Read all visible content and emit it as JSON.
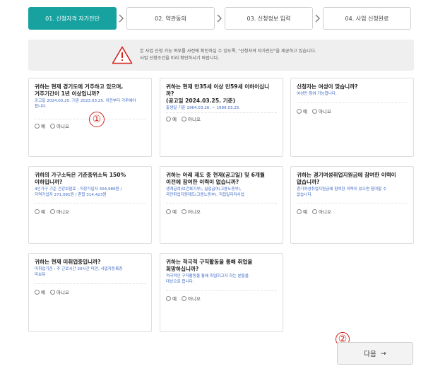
{
  "steps": [
    {
      "label": "01. 신청자격 자가진단",
      "active": true
    },
    {
      "label": "02. 약관동의",
      "active": false
    },
    {
      "label": "03. 신청정보 입력",
      "active": false
    },
    {
      "label": "04. 사업 신청완료",
      "active": false
    }
  ],
  "notice": {
    "line1": "본 사업 신청 가능 여부를 사전에 확인하실 수 있도록, \"신청자격 자가진단\"을 제공하고 있습니다.",
    "line2": "사업 신청조건을 미리 확인하시기 바랍니다."
  },
  "questions": [
    {
      "q1": "귀하는 현재 경기도에 거주하고 있으며,",
      "q2": "거주기간이 1년 이상입니까?",
      "s1": "공고일 2024.03.25. 기준 2023.03.25. 이전부터 거주해야",
      "s2": "합니다."
    },
    {
      "q1": "귀하는 현재 만35세 이상 만59세 이하이십니까?",
      "q2": "(공고일 2024.03.25. 기준)",
      "s1": "출생일 기준 1964.03.26. ~ 1989.03.25.",
      "s2": ""
    },
    {
      "q1": "신청자는 여성이 맞습니까?",
      "q2": "",
      "s1": "여성만 참여 가능합니다.",
      "s2": ""
    },
    {
      "q1": "귀하의 가구소득은 기준중위소득 150%",
      "q2": "이하입니까?",
      "s1": "4인가구 기준 건강보험료 : 직장가입자 304,986원 /",
      "s2": "지역가입자 271,091원 / 혼합 314,423원"
    },
    {
      "q1": "귀하는 아래 제도 중 현재(공고일) 및 6개월",
      "q2": "이전에 참여한 이력이 없습니까?",
      "s1": "생계급여(보건복지부), 실업급여(고용노동부),",
      "s2": "국민취업지원제도(고용노동부), 직접일자리사업"
    },
    {
      "q1": "귀하는 경기여성취업지원금에 참여한 이력이",
      "q2": "없습니까?",
      "s1": "경기여성취업지원금에 참여한 이력이 있으면 참여할 수",
      "s2": "없습니다."
    },
    {
      "q1": "귀하는 현재 미취업중입니까?",
      "q2": "",
      "s1": "미취업기준 : 주 근로시간 20시간 미만, 사업자등록증",
      "s2": "미보유"
    },
    {
      "q1": "귀하는 적극적 구직활동을 통해 취업을",
      "q2": "희망하십니까?",
      "s1": "적극적인 구직활동을 통해 취업하고자 하는 분들을",
      "s2": "대상으로 합니다."
    }
  ],
  "options": {
    "yes": "예",
    "no": "아니오"
  },
  "markers": {
    "m1": "①",
    "m2": "②"
  },
  "next_button": {
    "label": "다음",
    "arrow": "→"
  },
  "icons": {
    "step_separator": "chevron-right-icon",
    "notice": "warning-triangle-icon"
  },
  "colors": {
    "accent": "#17a2a0",
    "warning": "#d2231f",
    "link": "#3a66c4",
    "notice_bg": "#efefef"
  }
}
